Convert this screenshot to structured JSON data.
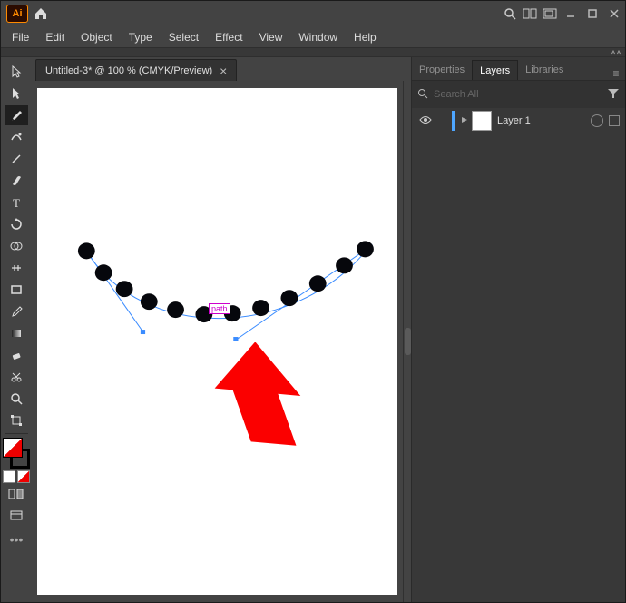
{
  "app": {
    "short": "Ai"
  },
  "menu": [
    "File",
    "Edit",
    "Object",
    "Type",
    "Select",
    "Effect",
    "View",
    "Window",
    "Help"
  ],
  "document": {
    "tab_label": "Untitled-3* @ 100 % (CMYK/Preview)",
    "close_glyph": "×",
    "path_label": "path"
  },
  "panels": {
    "tabs": [
      "Properties",
      "Layers",
      "Libraries"
    ],
    "active": "Layers",
    "search_placeholder": "Search All",
    "layer": {
      "name": "Layer 1"
    }
  }
}
